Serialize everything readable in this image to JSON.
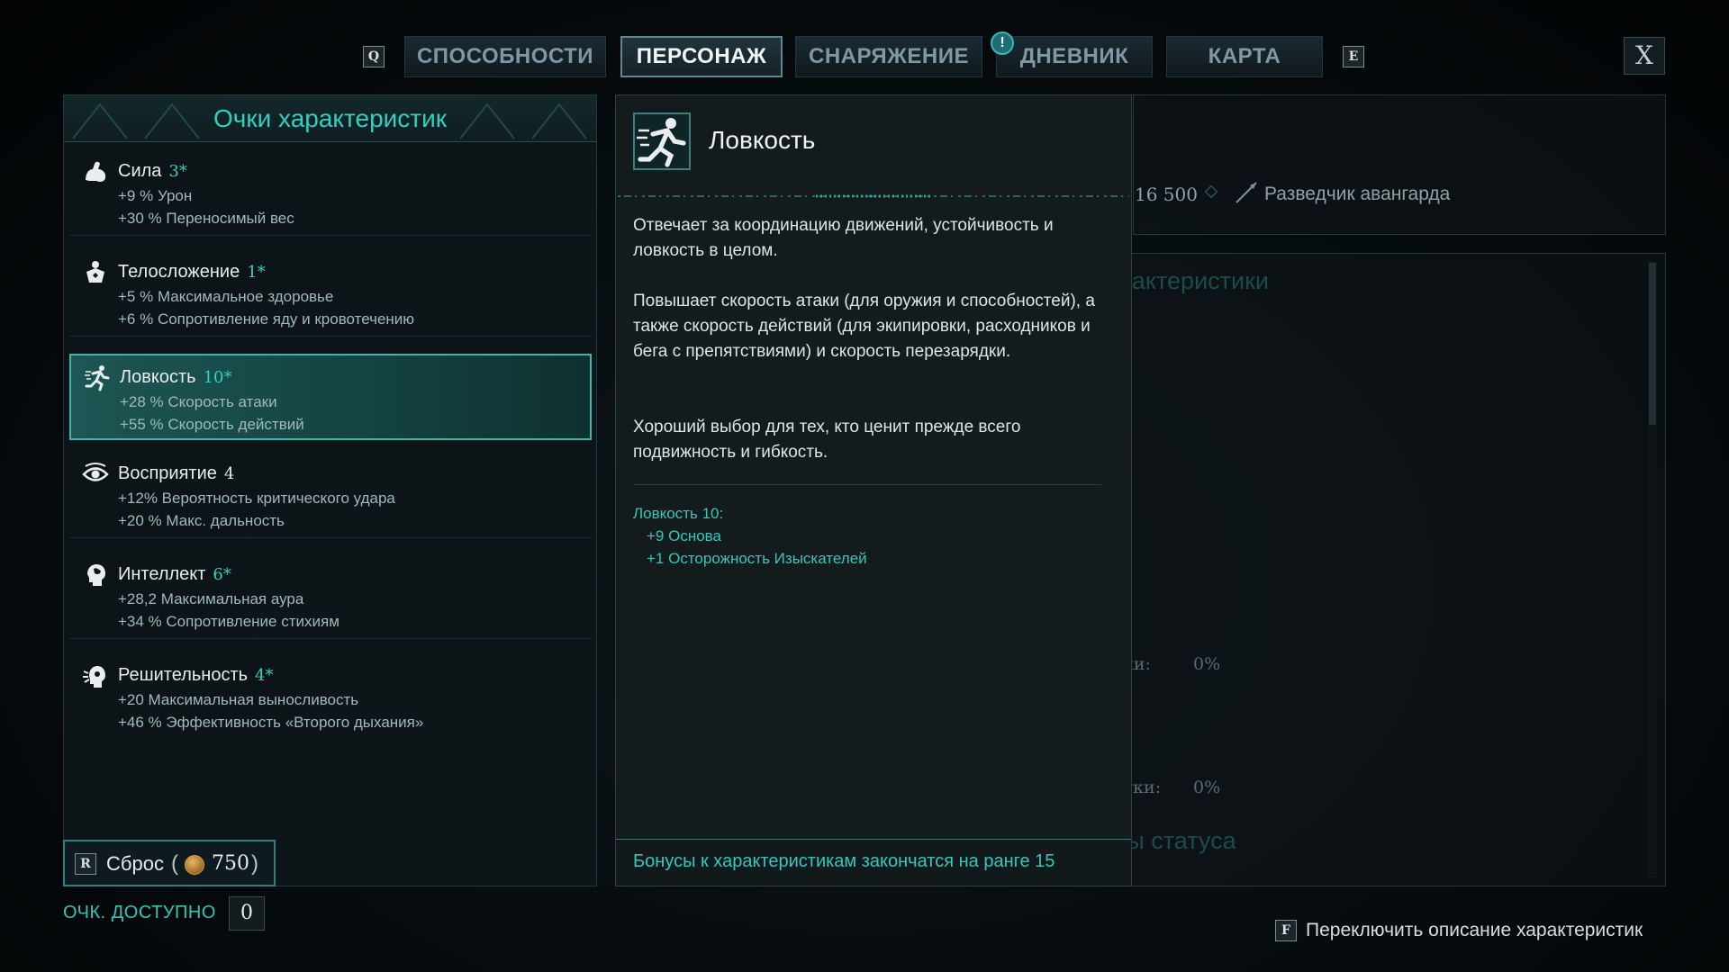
{
  "nav": {
    "prev_key": "Q",
    "next_key": "E",
    "tabs": [
      {
        "label": "СПОСОБНОСТИ",
        "active": false
      },
      {
        "label": "ПЕРСОНАЖ",
        "active": true
      },
      {
        "label": "СНАРЯЖЕНИЕ",
        "active": false
      },
      {
        "label": "ДНЕВНИК",
        "active": false,
        "badge": "!"
      },
      {
        "label": "КАРТА",
        "active": false
      }
    ],
    "close_label": "X"
  },
  "attributes": {
    "title": "Очки характеристик",
    "items": [
      {
        "icon": "flexed-arm-icon",
        "name": "Сила",
        "value": "3*",
        "lines": [
          "+9 % Урон",
          "+30 % Переносимый вес"
        ]
      },
      {
        "icon": "constitution-figure-icon",
        "name": "Телосложение",
        "value": "1*",
        "lines": [
          "+5 % Максимальное здоровье",
          "+6 % Сопротивление яду и кровотечению"
        ]
      },
      {
        "icon": "running-figure-icon",
        "name": "Ловкость",
        "value": "10*",
        "selected": true,
        "lines": [
          "+28 % Скорость атаки",
          "+55 % Скорость действий"
        ]
      },
      {
        "icon": "eye-icon",
        "name": "Восприятие",
        "value": "4",
        "lines": [
          "+12% Вероятность критического удара",
          "+20 % Макс. дальность"
        ]
      },
      {
        "icon": "brain-head-icon",
        "name": "Интеллект",
        "value": "6*",
        "lines": [
          "+28,2 Максимальная аура",
          "+34 % Сопротивление стихиям"
        ]
      },
      {
        "icon": "resolve-head-icon",
        "name": "Решительность",
        "value": "4*",
        "lines": [
          "+20 Максимальная выносливость",
          "+46 % Эффективность «Второго дыхания»"
        ]
      }
    ],
    "reset": {
      "key": "R",
      "label": "Сброс",
      "cost": "750",
      "open_paren": "(",
      "close_paren": ")"
    },
    "available_label": "ОЧК. ДОСТУПНО",
    "available_value": "0"
  },
  "tooltip": {
    "title": "Ловкость",
    "paragraphs": [
      "Отвечает за координацию движений, устойчивость и ловкость в целом.",
      "Повышает скорость атаки (для оружия и способностей), а также скорость действий (для экипировки, расходников и бега с препятствиями) и скорость перезарядки.",
      "Хороший выбор для тех, кто ценит прежде всего подвижность и гибкость."
    ],
    "breakdown_header": "Ловкость 10:",
    "breakdown": [
      "+9 Основа",
      "+1 Осторожность Изыскателей"
    ],
    "footer": "Бонусы к характеристикам закончатся на ранге 15"
  },
  "background_panel": {
    "level": "16 500",
    "class_name": "Разведчик авангарда",
    "section_main": "Основные характеристики",
    "section_status": "Эффекты статуса",
    "offhand_crit_current": "0%",
    "offhand_crit_extra": "0%",
    "crit_suffix": "ки:",
    "crit_suffix2": "уки:"
  },
  "hint": {
    "key": "F",
    "text": "Переключить описание характеристик"
  },
  "colors": {
    "accent": "#35c7b8",
    "selected_bg": "#1d5654",
    "text": "#dde5e7"
  }
}
